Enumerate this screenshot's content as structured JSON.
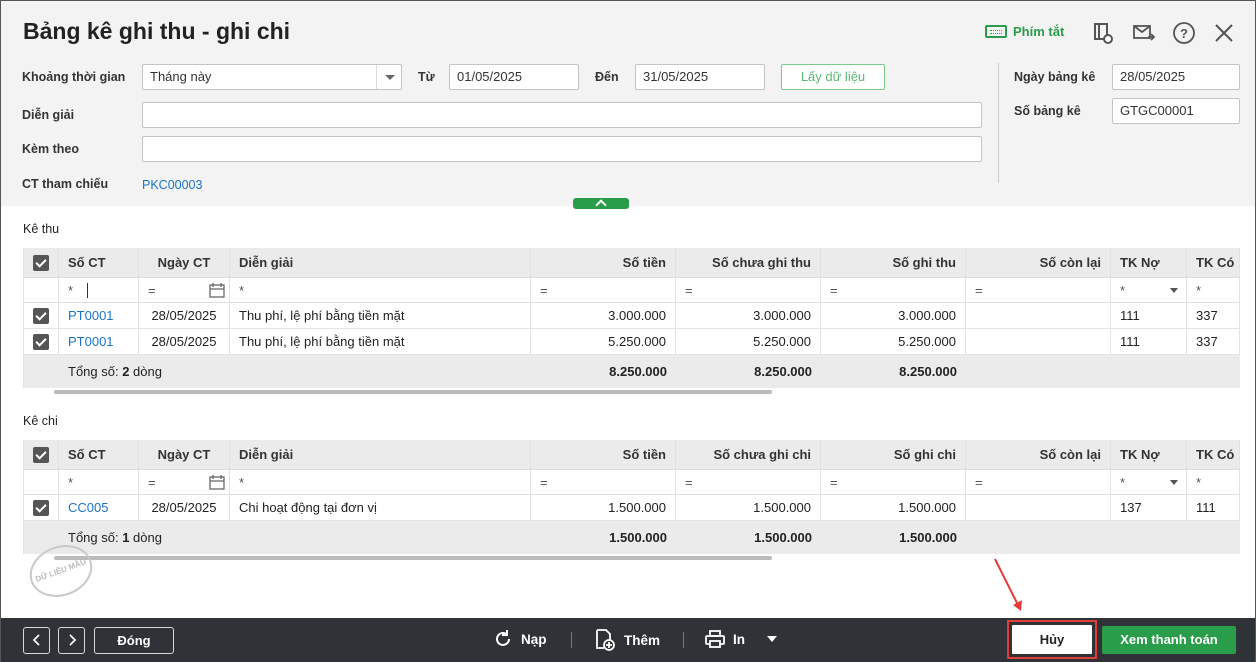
{
  "title": "Bảng kê ghi thu - ghi chi",
  "toolbar": {
    "hotkey_label": "Phím tắt"
  },
  "form": {
    "period_label": "Khoảng thời gian",
    "period_value": "Tháng này",
    "from_label": "Từ",
    "from_value": "01/05/2025",
    "to_label": "Đến",
    "to_value": "31/05/2025",
    "get_data_label": "Lấy dữ liệu",
    "desc_label": "Diễn giải",
    "desc_value": "",
    "attach_label": "Kèm theo",
    "attach_value": "",
    "ref_label": "CT tham chiếu",
    "ref_value": "PKC00003",
    "date_label": "Ngày bảng kê",
    "date_value": "28/05/2025",
    "number_label": "Số bảng kê",
    "number_value": "GTGC00001"
  },
  "income": {
    "section_label": "Kê thu",
    "columns": [
      "Số CT",
      "Ngày CT",
      "Diễn giải",
      "Số tiền",
      "Số chưa ghi thu",
      "Số ghi thu",
      "Số còn lại",
      "TK Nợ",
      "TK Có"
    ],
    "rows": [
      {
        "doc": "PT0001",
        "date": "28/05/2025",
        "desc": "Thu phí, lệ phí bằng tiền mặt",
        "amount": "3.000.000",
        "pending": "3.000.000",
        "recorded": "3.000.000",
        "remaining": "",
        "debit": "111",
        "credit": "337"
      },
      {
        "doc": "PT0001",
        "date": "28/05/2025",
        "desc": "Thu phí, lệ phí bằng tiền mặt",
        "amount": "5.250.000",
        "pending": "5.250.000",
        "recorded": "5.250.000",
        "remaining": "",
        "debit": "111",
        "credit": "337"
      }
    ],
    "total_prefix": "Tổng số: ",
    "total_count": "2",
    "total_suffix": " dòng",
    "total_amount": "8.250.000",
    "total_pending": "8.250.000",
    "total_recorded": "8.250.000"
  },
  "expense": {
    "section_label": "Kê chi",
    "columns": [
      "Số CT",
      "Ngày CT",
      "Diễn giải",
      "Số tiền",
      "Số chưa ghi chi",
      "Số ghi chi",
      "Số còn lại",
      "TK Nợ",
      "TK Có"
    ],
    "rows": [
      {
        "doc": "CC005",
        "date": "28/05/2025",
        "desc": "Chi hoạt động tại đơn vị",
        "amount": "1.500.000",
        "pending": "1.500.000",
        "recorded": "1.500.000",
        "remaining": "",
        "debit": "137",
        "credit": "111"
      }
    ],
    "total_prefix": "Tổng số: ",
    "total_count": "1",
    "total_suffix": " dòng",
    "total_amount": "1.500.000",
    "total_pending": "1.500.000",
    "total_recorded": "1.500.000"
  },
  "filter_ops": {
    "text": "*",
    "num": "="
  },
  "watermark": "DỮ LIỆU MẪU",
  "footer": {
    "close_label": "Đóng",
    "reload_label": "Nạp",
    "add_label": "Thêm",
    "print_label": "In",
    "cancel_label": "Hủy",
    "pay_label": "Xem thanh toán"
  },
  "colors": {
    "accent": "#2a9d4a",
    "link": "#1b74c8",
    "footer": "#2f3236",
    "highlight": "#e43b3b"
  }
}
